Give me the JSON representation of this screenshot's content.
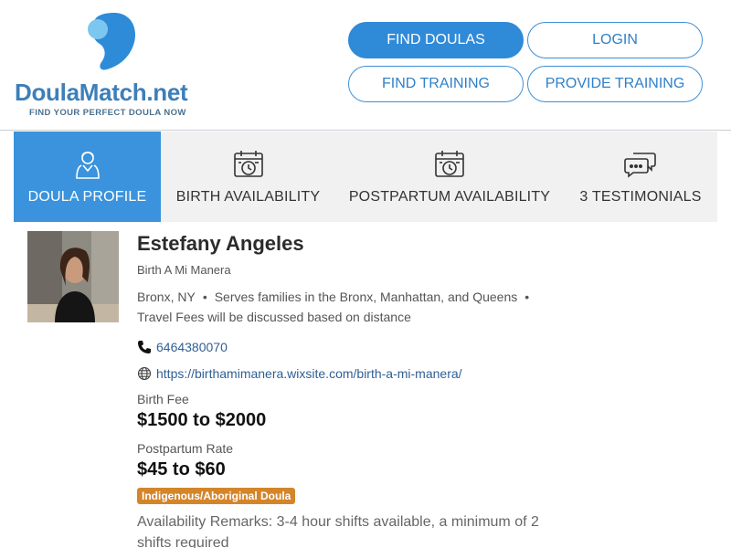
{
  "brand": {
    "name": "DoulaMatch",
    "tld": ".net",
    "tagline": "FIND YOUR PERFECT DOULA NOW",
    "color_primary": "#3a93dc",
    "color_logo_light": "#7cc7f0"
  },
  "nav": {
    "find_doulas": "FIND DOULAS",
    "login": "LOGIN",
    "find_training": "FIND TRAINING",
    "provide_training": "PROVIDE TRAINING"
  },
  "tabs": [
    {
      "label": "DOULA PROFILE",
      "icon": "doula-person-icon",
      "active": true
    },
    {
      "label": "BIRTH AVAILABILITY",
      "icon": "calendar-clock-icon",
      "active": false
    },
    {
      "label": "POSTPARTUM AVAILABILITY",
      "icon": "calendar-clock-icon",
      "active": false
    },
    {
      "label": "3 TESTIMONIALS",
      "icon": "chat-bubbles-icon",
      "active": false
    }
  ],
  "profile": {
    "name": "Estefany Angeles",
    "business": "Birth A Mi Manera",
    "city": "Bronx, NY",
    "serves": "Serves families in the Bronx, Manhattan, and Queens",
    "travel": "Travel Fees will be discussed based on distance",
    "phone": "6464380070",
    "website": "https://birthamimanera.wixsite.com/birth-a-mi-manera/",
    "birth_fee_label": "Birth Fee",
    "birth_fee": "$1500 to $2000",
    "postpartum_label": "Postpartum Rate",
    "postpartum_rate": "$45 to $60",
    "badge": "Indigenous/Aboriginal Doula",
    "badge_color": "#d4852a",
    "remarks": "Availability Remarks: 3-4 hour shifts available, a minimum of 2 shifts required"
  }
}
